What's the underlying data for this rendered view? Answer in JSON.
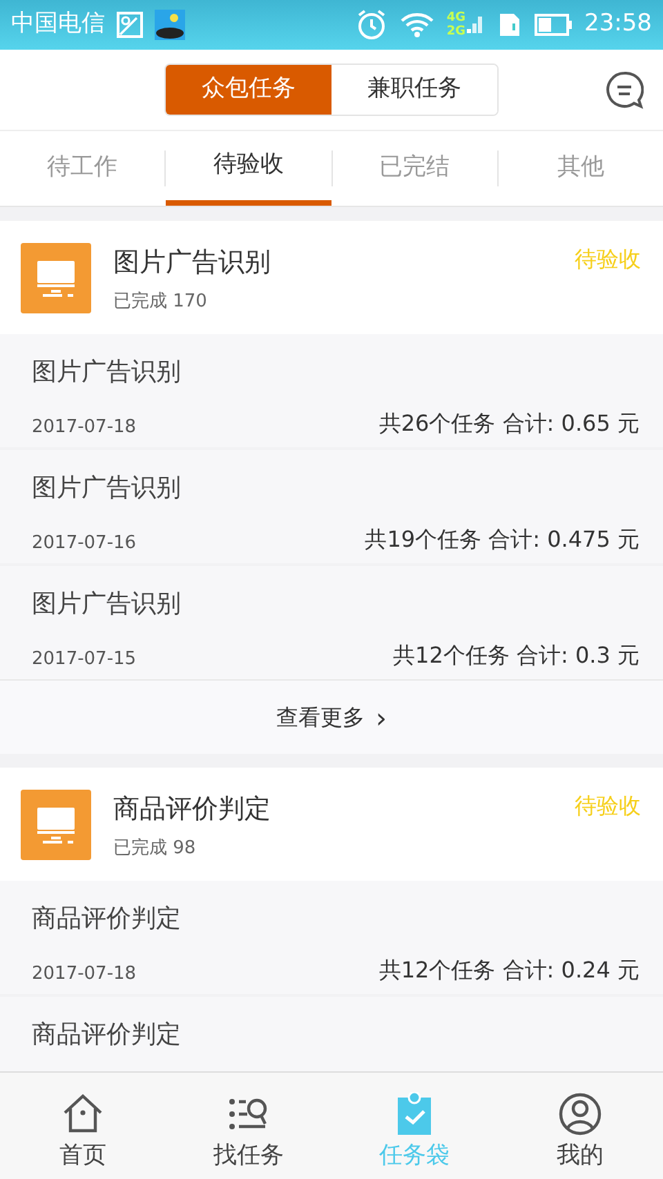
{
  "status_bar": {
    "carrier": "中国电信",
    "network_top": "4G",
    "network_bottom": "2G",
    "time": "23:58"
  },
  "segments": [
    {
      "label": "众包任务",
      "selected": true
    },
    {
      "label": "兼职任务",
      "selected": false
    }
  ],
  "tabs": [
    {
      "label": "待工作",
      "selected": false
    },
    {
      "label": "待验收",
      "selected": true
    },
    {
      "label": "已完结",
      "selected": false
    },
    {
      "label": "其他",
      "selected": false
    }
  ],
  "groups": [
    {
      "title": "图片广告识别",
      "completed": "已完成 170",
      "status": "待验收",
      "more": "查看更多",
      "more_icon": "›",
      "items": [
        {
          "title": "图片广告识别",
          "date": "2017-07-18",
          "total": "共26个任务 合计: 0.65 元"
        },
        {
          "title": "图片广告识别",
          "date": "2017-07-16",
          "total": "共19个任务 合计: 0.475 元"
        },
        {
          "title": "图片广告识别",
          "date": "2017-07-15",
          "total": "共12个任务 合计: 0.3 元"
        }
      ]
    },
    {
      "title": "商品评价判定",
      "completed": "已完成 98",
      "status": "待验收",
      "items": [
        {
          "title": "商品评价判定",
          "date": "2017-07-18",
          "total": "共12个任务 合计: 0.24 元"
        },
        {
          "title": "商品评价判定"
        }
      ]
    }
  ],
  "bottom_nav": [
    {
      "label": "首页",
      "kind": "home",
      "selected": false
    },
    {
      "label": "找任务",
      "kind": "search",
      "selected": false
    },
    {
      "label": "任务袋",
      "kind": "bag",
      "selected": true
    },
    {
      "label": "我的",
      "kind": "profile",
      "selected": false
    }
  ]
}
